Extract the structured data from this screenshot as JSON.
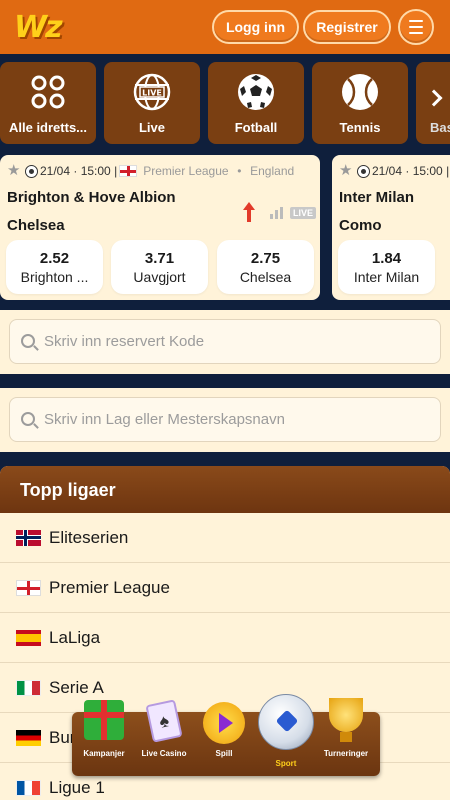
{
  "header": {
    "logo": "Wz",
    "login": "Logg inn",
    "register": "Registrer"
  },
  "categories": [
    {
      "label": "Alle idretts...",
      "icon": "grid-icon"
    },
    {
      "label": "Live",
      "icon": "live-globe-icon"
    },
    {
      "label": "Fotball",
      "icon": "soccer-ball-icon"
    },
    {
      "label": "Tennis",
      "icon": "tennis-ball-icon"
    },
    {
      "label": "Bas",
      "icon": "basketball-icon"
    }
  ],
  "matches": [
    {
      "date": "21/04",
      "time": "15:00",
      "league": "Premier League",
      "country": "England",
      "home": "Brighton & Hove Albion",
      "away": "Chelsea",
      "live_badge": "LIVE",
      "odds": [
        {
          "value": "2.52",
          "label": "Brighton ..."
        },
        {
          "value": "3.71",
          "label": "Uavgjort"
        },
        {
          "value": "2.75",
          "label": "Chelsea"
        }
      ]
    },
    {
      "date": "21/04",
      "time": "15:00",
      "home": "Inter Milan",
      "away": "Como",
      "odds": [
        {
          "value": "1.84",
          "label": "Inter Milan"
        }
      ]
    }
  ],
  "search": {
    "code_placeholder": "Skriv inn reservert Kode",
    "team_placeholder": "Skriv inn Lag eller Mesterskapsnavn"
  },
  "top_leagues": {
    "title": "Topp ligaer",
    "items": [
      {
        "label": "Eliteserien",
        "flag": "norway"
      },
      {
        "label": "Premier League",
        "flag": "england"
      },
      {
        "label": "LaLiga",
        "flag": "spain"
      },
      {
        "label": "Serie A",
        "flag": "italy"
      },
      {
        "label": "Bundesliga",
        "flag": "germany"
      },
      {
        "label": "Ligue 1",
        "flag": "france"
      }
    ]
  },
  "bottom_nav": [
    {
      "label": "Kampanjer",
      "icon": "gift-icon"
    },
    {
      "label": "Live Casino",
      "icon": "cards-icon"
    },
    {
      "label": "Spill",
      "icon": "play-icon"
    },
    {
      "label": "Sport",
      "icon": "soccer-ball-icon",
      "active": true
    },
    {
      "label": "Turneringer",
      "icon": "trophy-icon"
    }
  ],
  "colors": {
    "header": "#e06a12",
    "accent_yellow": "#ffd01a",
    "card_bg": "#fff3d9",
    "dark_bg": "#0f1f3c",
    "brown": "#7a3f12"
  }
}
